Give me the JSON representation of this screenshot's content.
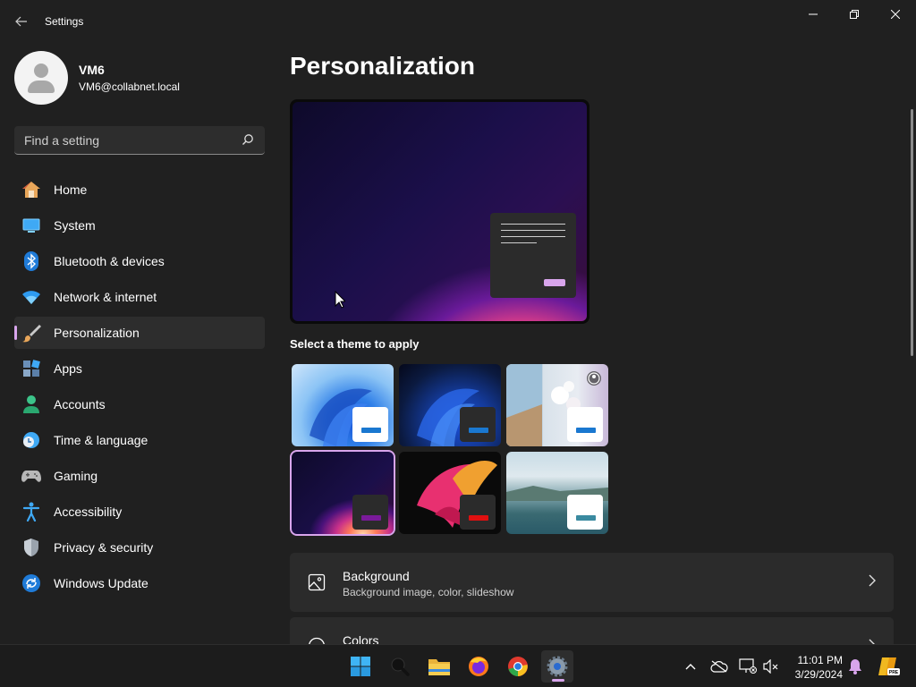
{
  "window": {
    "title": "Settings",
    "back_icon": "back-arrow-icon"
  },
  "profile": {
    "name": "VM6",
    "email": "VM6@collabnet.local"
  },
  "search": {
    "placeholder": "Find a setting"
  },
  "sidebar": {
    "items": [
      {
        "label": "Home",
        "icon": "home-icon",
        "active": false
      },
      {
        "label": "System",
        "icon": "system-icon",
        "active": false
      },
      {
        "label": "Bluetooth & devices",
        "icon": "bluetooth-icon",
        "active": false
      },
      {
        "label": "Network & internet",
        "icon": "wifi-icon",
        "active": false
      },
      {
        "label": "Personalization",
        "icon": "paintbrush-icon",
        "active": true
      },
      {
        "label": "Apps",
        "icon": "apps-icon",
        "active": false
      },
      {
        "label": "Accounts",
        "icon": "accounts-icon",
        "active": false
      },
      {
        "label": "Time & language",
        "icon": "clock-globe-icon",
        "active": false
      },
      {
        "label": "Gaming",
        "icon": "gamepad-icon",
        "active": false
      },
      {
        "label": "Accessibility",
        "icon": "accessibility-icon",
        "active": false
      },
      {
        "label": "Privacy & security",
        "icon": "shield-icon",
        "active": false
      },
      {
        "label": "Windows Update",
        "icon": "windows-update-icon",
        "active": false
      }
    ]
  },
  "main": {
    "title": "Personalization",
    "theme_heading": "Select a theme to apply",
    "themes": [
      {
        "name": "windows-light",
        "selected": false
      },
      {
        "name": "windows-dark",
        "selected": false
      },
      {
        "name": "windows-spotlight",
        "selected": false
      },
      {
        "name": "glow",
        "selected": true
      },
      {
        "name": "captured-motion",
        "selected": false
      },
      {
        "name": "flow",
        "selected": false
      }
    ],
    "cards": [
      {
        "title": "Background",
        "subtitle": "Background image, color, slideshow",
        "icon": "background-image-icon"
      },
      {
        "title": "Colors",
        "subtitle": "",
        "icon": "palette-icon"
      }
    ]
  },
  "taskbar": {
    "apps": [
      "start-icon",
      "search-icon",
      "file-explorer-icon",
      "firefox-icon",
      "chrome-icon",
      "settings-icon"
    ],
    "active_app": "settings-icon",
    "time": "11:01 PM",
    "date": "3/29/2024"
  },
  "colors": {
    "accent": "#d8a5ec",
    "background": "#202020",
    "card": "#2b2b2b"
  }
}
